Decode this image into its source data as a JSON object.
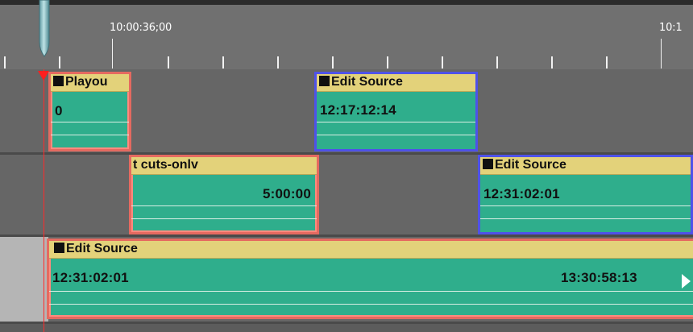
{
  "ruler": {
    "label_main": "10:00:36;00",
    "label_right": "10:1"
  },
  "tracks": [
    {
      "clips": [
        {
          "title": "Playou",
          "value": "0"
        },
        {
          "title": "Edit Source",
          "value": "12:17:12:14"
        }
      ]
    },
    {
      "clips": [
        {
          "title": "t cuts-onlv",
          "value": "5:00:00"
        },
        {
          "title": "Edit Source",
          "value": "12:31:02:01"
        }
      ]
    },
    {
      "clips": [
        {
          "title": "Edit Source",
          "start": "12:31:02:01",
          "end": "13:30:58:13"
        }
      ]
    }
  ],
  "colors": {
    "clip_body": "#2fae8c",
    "clip_header": "#e3d27a",
    "border_red": "#c8342f",
    "border_blue": "#4f52e8",
    "playhead": "#ff2a2a"
  },
  "icons": {
    "playhead": "playhead-marker-icon",
    "scrubber": "scrubber-handle-icon",
    "clip_flag": "clip-square-icon",
    "continue": "continue-arrow-icon"
  }
}
